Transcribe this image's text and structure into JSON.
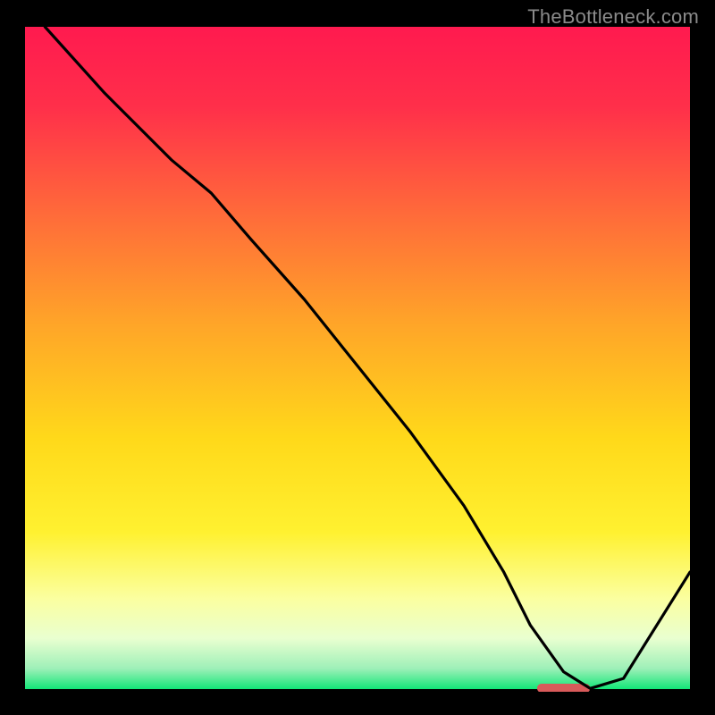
{
  "watermark": "TheBottleneck.com",
  "colors": {
    "gradient_stops": [
      {
        "offset": 0.0,
        "color": "#ff1a4f"
      },
      {
        "offset": 0.12,
        "color": "#ff2f4a"
      },
      {
        "offset": 0.28,
        "color": "#ff6a3a"
      },
      {
        "offset": 0.45,
        "color": "#ffa628"
      },
      {
        "offset": 0.62,
        "color": "#ffd91a"
      },
      {
        "offset": 0.76,
        "color": "#fff130"
      },
      {
        "offset": 0.86,
        "color": "#fbffa0"
      },
      {
        "offset": 0.92,
        "color": "#e9ffd0"
      },
      {
        "offset": 0.965,
        "color": "#9ef0b8"
      },
      {
        "offset": 1.0,
        "color": "#00e56f"
      }
    ],
    "curve": "#000000",
    "marker": "#d85a5a",
    "baseline": "#000000"
  },
  "chart_data": {
    "type": "line",
    "title": "",
    "xlabel": "",
    "ylabel": "",
    "xlim": [
      0,
      100
    ],
    "ylim": [
      0,
      100
    ],
    "grid": false,
    "legend": false,
    "x": [
      3,
      12,
      22,
      28,
      34,
      42,
      50,
      58,
      66,
      72,
      76,
      81,
      85,
      90,
      100
    ],
    "values": [
      100,
      90,
      80,
      75,
      68,
      59,
      49,
      39,
      28,
      18,
      10,
      3,
      0.5,
      2,
      18
    ],
    "annotations": [],
    "marker_segment_x": [
      77,
      85
    ]
  }
}
